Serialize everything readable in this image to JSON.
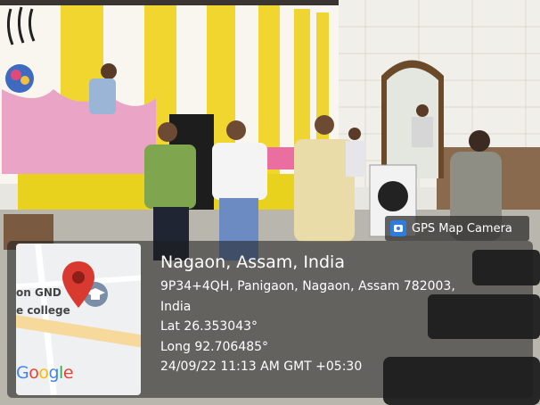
{
  "badge": {
    "label": "GPS Map Camera",
    "icon": "camera-icon"
  },
  "map": {
    "label_top": "on GND",
    "label_bottom": "e college",
    "logo": "Google",
    "pin_icon": "map-pin-icon",
    "school_icon": "graduation-cap-icon"
  },
  "location": {
    "title": "Nagaon, Assam, India",
    "address_line1": "9P34+4QH, Panigaon, Nagaon, Assam 782003,",
    "address_line2": "India",
    "lat": "Lat 26.353043°",
    "long": "Long 92.706485°",
    "datetime": "24/09/22 11:13 AM GMT +05:30"
  },
  "colors": {
    "curtain_yellow": "#f2d630",
    "curtain_white": "#f8f6ef",
    "pink_drape": "#e9a4c6",
    "pin_red": "#d93a2f",
    "overlay": "#1e1e1e"
  }
}
